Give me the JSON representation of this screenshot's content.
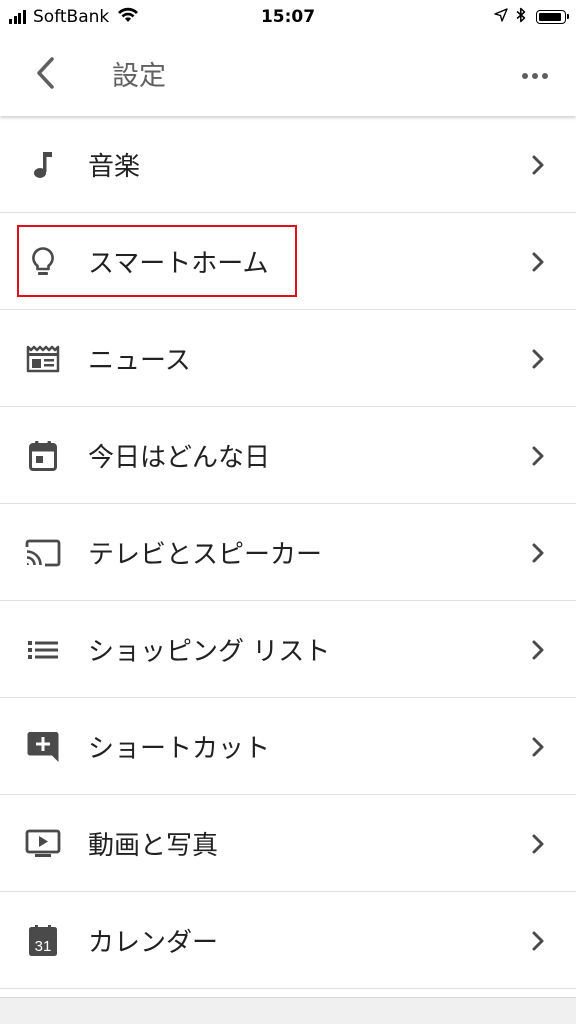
{
  "status_bar": {
    "carrier": "SoftBank",
    "time": "15:07"
  },
  "header": {
    "title": "設定",
    "back_icon": "chevron-left-icon",
    "more_icon": "more-horiz-icon"
  },
  "colors": {
    "icon": "#4a4a4a",
    "text": "#212121",
    "divider": "#e0e0e0",
    "highlight": "#e0101a"
  },
  "menu": {
    "items": [
      {
        "label": "音楽",
        "icon": "music-note-icon"
      },
      {
        "label": "スマートホーム",
        "icon": "lightbulb-icon",
        "highlighted": true
      },
      {
        "label": "ニュース",
        "icon": "news-icon"
      },
      {
        "label": "今日はどんな日",
        "icon": "calendar-day-icon"
      },
      {
        "label": "テレビとスピーカー",
        "icon": "cast-icon"
      },
      {
        "label": "ショッピング リスト",
        "icon": "list-icon"
      },
      {
        "label": "ショートカット",
        "icon": "add-comment-icon"
      },
      {
        "label": "動画と写真",
        "icon": "video-play-icon"
      },
      {
        "label": "カレンダー",
        "icon": "google-calendar-icon",
        "icon_text": "31"
      }
    ]
  }
}
